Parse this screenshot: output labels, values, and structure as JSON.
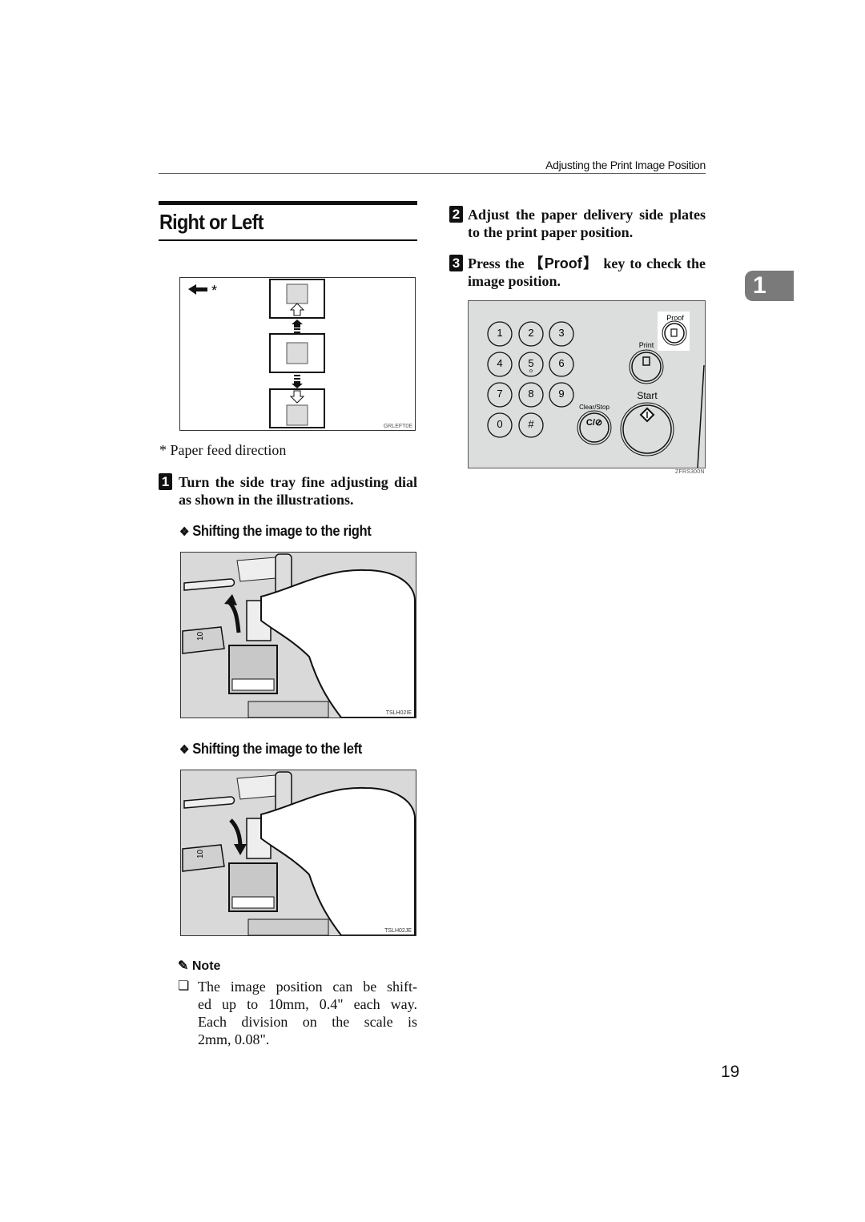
{
  "header": {
    "running_title": "Adjusting the Print Image Position"
  },
  "chapter_tab": {
    "label": "1"
  },
  "section": {
    "title": "Right or Left"
  },
  "diagram_feed": {
    "legend_symbol": "*",
    "figure_code": "GRLEFT0E",
    "caption": "* Paper feed direction"
  },
  "steps": [
    {
      "number": "1",
      "text": "Turn the side tray fine adjusting dial as shown in the illustrations."
    },
    {
      "number": "2",
      "text": "Adjust the paper delivery side plates to the print paper position."
    },
    {
      "number": "3",
      "text_before": "Press the ",
      "key": "【Proof】",
      "text_after": " key to check the image position."
    }
  ],
  "subsections": [
    {
      "bullet": "❖",
      "title": "Shifting the image to the right",
      "figure_code": "TSLH02IE",
      "dial_label": "10"
    },
    {
      "bullet": "❖",
      "title": "Shifting the image to the left",
      "figure_code": "TSLH02JE",
      "dial_label": "10"
    }
  ],
  "control_panel": {
    "figure_code": "ZFRS300N",
    "keypad": [
      "1",
      "2",
      "3",
      "4",
      "5",
      "6",
      "7",
      "8",
      "9",
      "0",
      "#"
    ],
    "proof_label": "Proof",
    "print_label": "Print",
    "start_label": "Start",
    "clear_stop_label": "Clear/Stop",
    "clear_stop_glyph": "C/⊘"
  },
  "note": {
    "title": "Note",
    "items": [
      "The image position can be shifted up to 10mm, 0.4\" each way. Each division on the scale is 2mm, 0.08\"."
    ],
    "item_marker": "❏",
    "item_display_lines": [
      "The image position can be shift-",
      "ed up to 10mm, 0.4\" each way.",
      "Each division on the scale is",
      "2mm, 0.08\"."
    ]
  },
  "page_number": "19"
}
